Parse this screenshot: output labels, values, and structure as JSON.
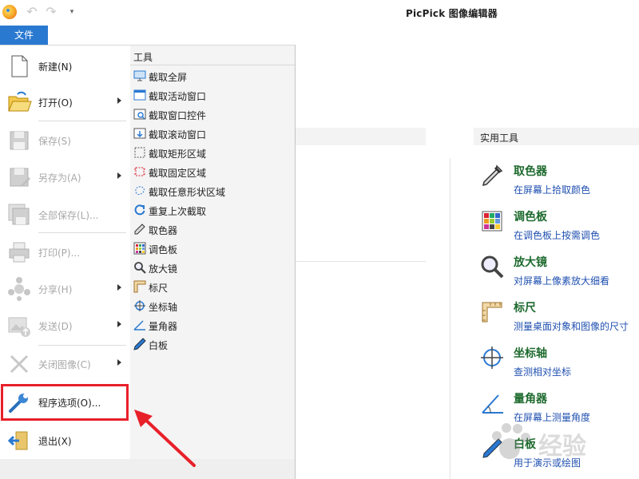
{
  "window": {
    "title": "PicPick 图像编辑器"
  },
  "quick_access": {
    "undo_icon": "undo-icon",
    "redo_icon": "redo-icon",
    "dropdown_icon": "chevron-down-icon"
  },
  "file_tab": {
    "label": "文件"
  },
  "file_menu": {
    "items": [
      {
        "label": "新建(N)",
        "icon": "new-file-icon",
        "disabled": false,
        "submenu": false
      },
      {
        "label": "打开(O)",
        "icon": "open-folder-icon",
        "disabled": false,
        "submenu": true
      },
      {
        "label": "保存(S)",
        "icon": "save-icon",
        "disabled": true,
        "submenu": false
      },
      {
        "label": "另存为(A)",
        "icon": "save-as-icon",
        "disabled": true,
        "submenu": true
      },
      {
        "label": "全部保存(L)...",
        "icon": "save-all-icon",
        "disabled": true,
        "submenu": false
      },
      {
        "label": "打印(P)...",
        "icon": "print-icon",
        "disabled": true,
        "submenu": false
      },
      {
        "label": "分享(H)",
        "icon": "share-icon",
        "disabled": true,
        "submenu": true
      },
      {
        "label": "发送(D)",
        "icon": "send-icon",
        "disabled": true,
        "submenu": true
      },
      {
        "label": "关闭图像(C)",
        "icon": "close-icon",
        "disabled": true,
        "submenu": true
      },
      {
        "label": "程序选项(O)...",
        "icon": "wrench-icon",
        "disabled": false,
        "submenu": false,
        "highlighted": true
      },
      {
        "label": "退出(X)",
        "icon": "exit-icon",
        "disabled": false,
        "submenu": false
      }
    ]
  },
  "tools_panel": {
    "heading": "工具",
    "items": [
      {
        "label": "截取全屏",
        "icon": "monitor-icon"
      },
      {
        "label": "截取活动窗口",
        "icon": "window-icon"
      },
      {
        "label": "截取窗口控件",
        "icon": "window-control-icon"
      },
      {
        "label": "截取滚动窗口",
        "icon": "scroll-window-icon"
      },
      {
        "label": "截取矩形区域",
        "icon": "rectangle-select-icon"
      },
      {
        "label": "截取固定区域",
        "icon": "fixed-region-icon"
      },
      {
        "label": "截取任意形状区域",
        "icon": "freeform-icon"
      },
      {
        "label": "重复上次截取",
        "icon": "repeat-icon"
      },
      {
        "label": "取色器",
        "icon": "eyedropper-icon"
      },
      {
        "label": "调色板",
        "icon": "palette-icon"
      },
      {
        "label": "放大镜",
        "icon": "magnifier-icon"
      },
      {
        "label": "标尺",
        "icon": "ruler-icon"
      },
      {
        "label": "坐标轴",
        "icon": "crosshair-icon"
      },
      {
        "label": "量角器",
        "icon": "protractor-icon"
      },
      {
        "label": "白板",
        "icon": "pen-icon"
      }
    ]
  },
  "utilities": {
    "heading": "实用工具",
    "items": [
      {
        "title": "取色器",
        "desc": "在屏幕上拾取颜色",
        "icon": "eyedropper-icon"
      },
      {
        "title": "调色板",
        "desc": "在调色板上按需调色",
        "icon": "palette-icon"
      },
      {
        "title": "放大镜",
        "desc": "对屏幕上像素放大细看",
        "icon": "magnifier-icon"
      },
      {
        "title": "标尺",
        "desc": "测量桌面对象和图像的尺寸",
        "icon": "ruler-icon"
      },
      {
        "title": "坐标轴",
        "desc": "查测相对坐标",
        "icon": "crosshair-icon"
      },
      {
        "title": "量角器",
        "desc": "在屏幕上测量角度",
        "icon": "protractor-icon"
      },
      {
        "title": "白板",
        "desc": "用于演示或绘图",
        "icon": "pen-icon"
      }
    ]
  },
  "watermark": {
    "text": "经验"
  },
  "colors": {
    "accent": "#2a79d1",
    "highlight_box": "#e8202a",
    "util_title": "#1d6a2e",
    "util_desc": "#2050b0"
  }
}
